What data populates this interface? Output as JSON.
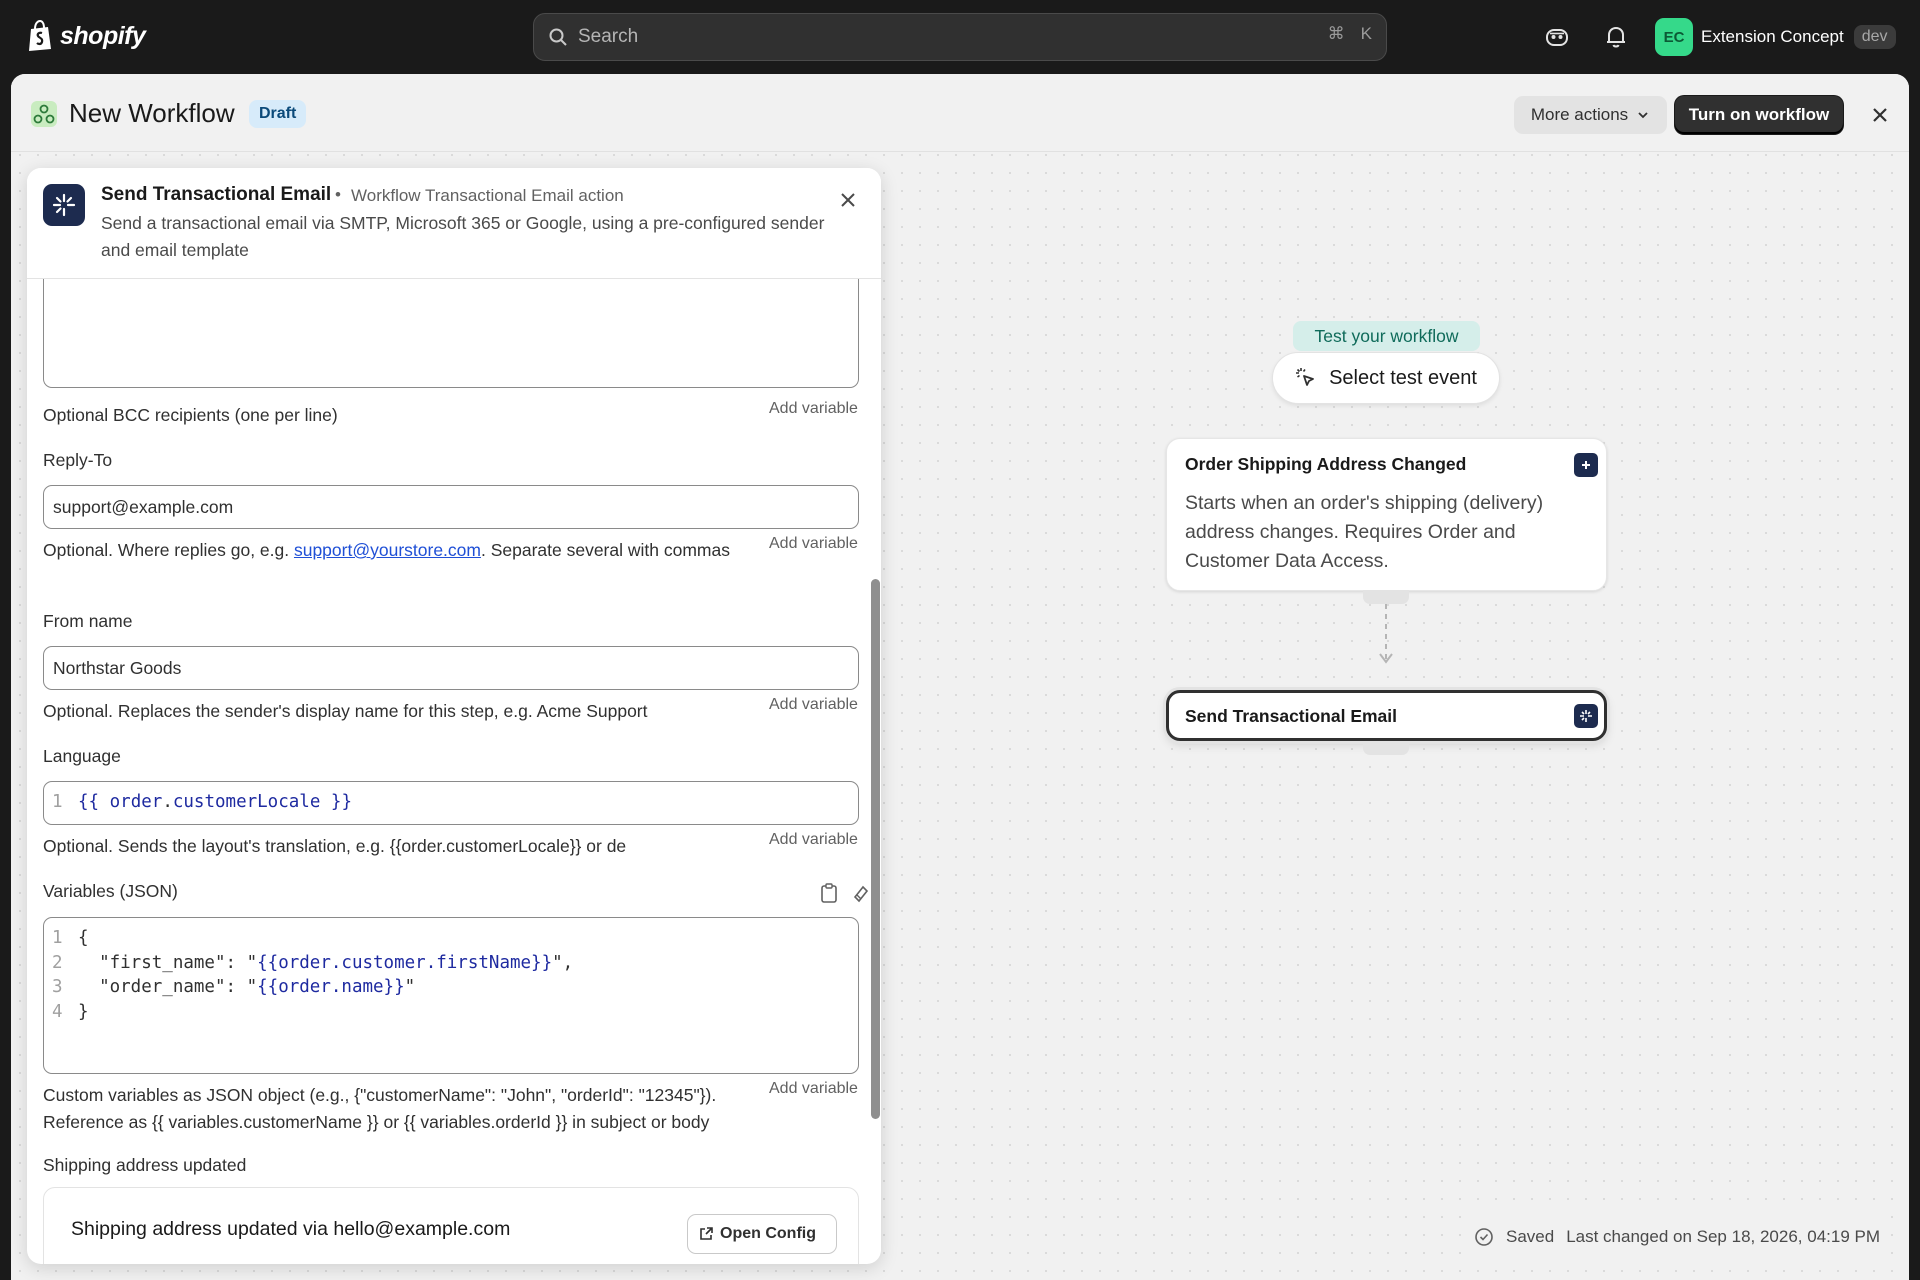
{
  "topbar": {
    "brand": "shopify",
    "search_placeholder": "Search",
    "shortcut_mod": "⌘",
    "shortcut_key": "K",
    "account_initials": "EC",
    "account_name": "Extension Concept",
    "account_badge": "dev"
  },
  "header": {
    "title": "New Workflow",
    "status": "Draft",
    "more_actions": "More actions",
    "turn_on": "Turn on workflow"
  },
  "panel": {
    "title": "Send Transactional Email",
    "bullet": "•",
    "subtitle": "Workflow Transactional Email action",
    "description": "Send a transactional email via SMTP, Microsoft 365 or Google, using a pre-configured sender and email template",
    "add_variable": "Add variable",
    "bcc_help": "Optional BCC recipients (one per line)",
    "reply_to": {
      "label": "Reply-To",
      "value": "support@example.com",
      "help_prefix": "Optional. Where replies go, e.g. ",
      "help_link": "support@yourstore.com",
      "help_suffix": ". Separate several with commas"
    },
    "from_name": {
      "label": "From name",
      "value": "Northstar Goods",
      "help": "Optional. Replaces the sender's display name for this step, e.g. Acme Support"
    },
    "language": {
      "label": "Language",
      "line_no": "1",
      "open": "{{",
      "var_obj": "order",
      "dot": ".",
      "var_prop": "customerLocale",
      "close": "}}",
      "help": "Optional. Sends the layout's translation, e.g. {{order.customerLocale}} or de"
    },
    "variables": {
      "label": "Variables (JSON)",
      "lines": [
        {
          "n": "1",
          "text": "{"
        },
        {
          "n": "2",
          "key": "  \"first_name\": \"",
          "tpl": "{{order.customer.firstName}}",
          "end": "\","
        },
        {
          "n": "3",
          "key": "  \"order_name\": \"",
          "tpl": "{{order.name}}",
          "end": "\""
        },
        {
          "n": "4",
          "text": "}"
        }
      ],
      "help": "Custom variables as JSON object (e.g., {\"customerName\": \"John\", \"orderId\": \"12345\"}). Reference as {{ variables.customerName }} or {{ variables.orderId }} in subject or body"
    },
    "shipping": {
      "label": "Shipping address updated",
      "card_text": "Shipping address updated via hello@example.com",
      "open_config": "Open Config"
    }
  },
  "canvas": {
    "test_tag": "Test your workflow",
    "select_event": "Select test event",
    "trigger": {
      "title": "Order Shipping Address Changed",
      "description": "Starts when an order's shipping (delivery) address changes. Requires Order and Customer Data Access."
    },
    "action": {
      "title": "Send Transactional Email"
    }
  },
  "footer": {
    "saved": "Saved",
    "last_changed": "Last changed on Sep 18, 2026, 04:19 PM"
  }
}
